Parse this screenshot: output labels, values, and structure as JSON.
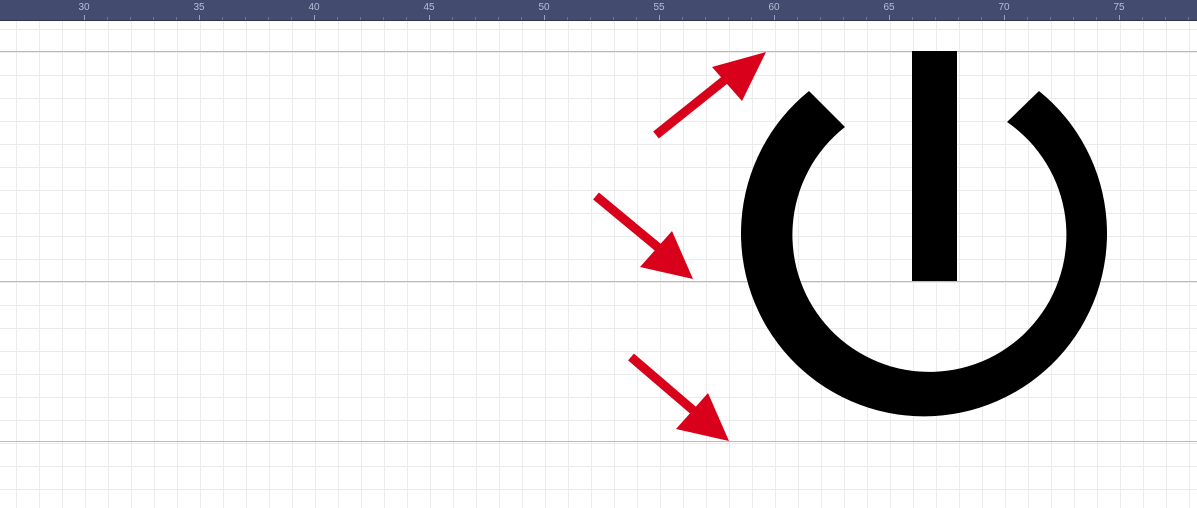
{
  "ruler": {
    "labels": [
      "30",
      "35",
      "40",
      "45",
      "50",
      "55",
      "60",
      "65",
      "70",
      "75"
    ]
  },
  "colors": {
    "ruler_bg": "#434b6e",
    "grid_line": "#ebebeb",
    "guide_line": "#f0a59a",
    "arrow": "#d9001b",
    "icon": "#000000"
  },
  "icons": {
    "main": "power-icon",
    "pointer": "arrow-icon"
  }
}
